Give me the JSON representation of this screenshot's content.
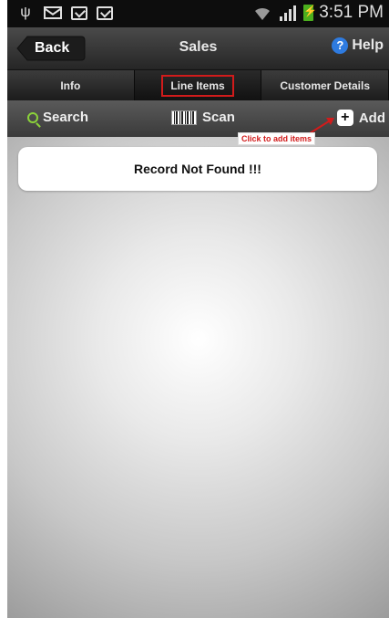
{
  "status_bar": {
    "time": "3:51 PM"
  },
  "header": {
    "back_label": "Back",
    "title": "Sales",
    "help_label": "Help"
  },
  "tabs": [
    {
      "label": "Info"
    },
    {
      "label": "Line Items"
    },
    {
      "label": "Customer Details"
    }
  ],
  "actions": {
    "search_label": "Search",
    "scan_label": "Scan",
    "add_label": "Add"
  },
  "annotation": {
    "add_hint": "Click to add items"
  },
  "content": {
    "message": "Record Not Found !!!"
  },
  "colors": {
    "highlight_red": "#d11b1b",
    "help_blue": "#2e7be0",
    "battery_green": "#4caf1e",
    "search_green": "#8bd23a"
  }
}
